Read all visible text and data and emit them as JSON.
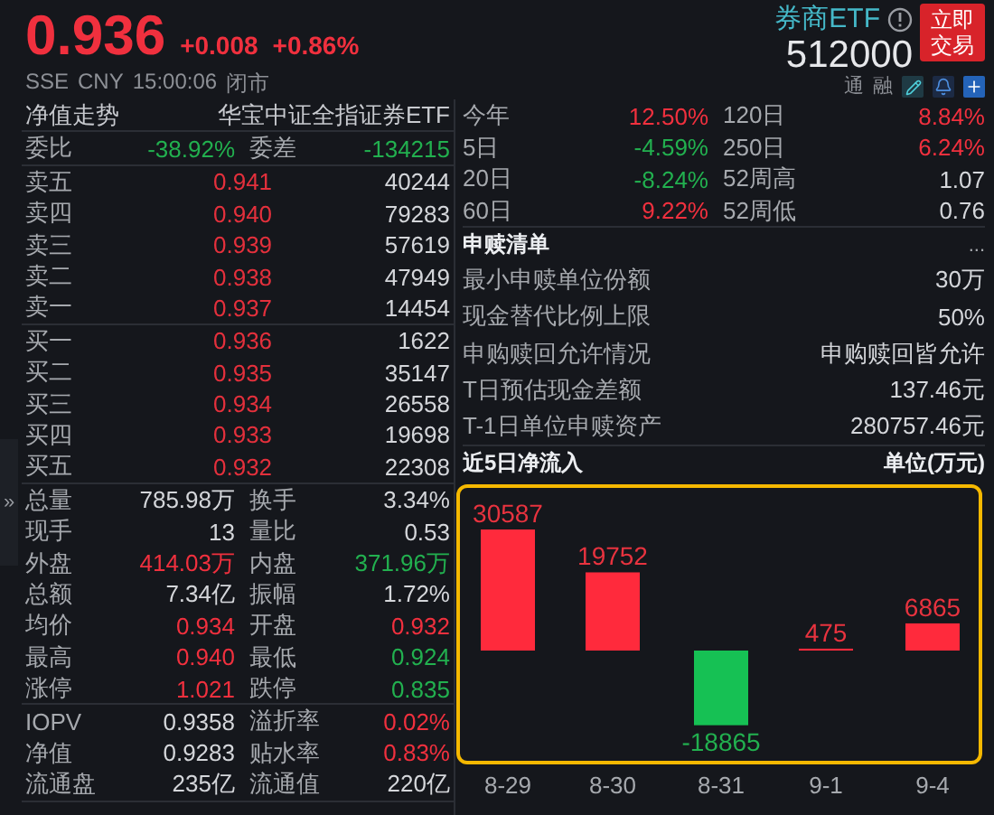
{
  "quote": {
    "price": "0.936",
    "change": "+0.008",
    "change_pct": "+0.86%",
    "exchange": "SSE",
    "currency": "CNY",
    "time": "15:00:06",
    "status": "闭市"
  },
  "security": {
    "name": "券商ETF",
    "code": "512000",
    "trade_button": [
      "立即",
      "交易"
    ],
    "tags": [
      "通",
      "融"
    ]
  },
  "side_toggle": "»",
  "order_book": {
    "title": "净值走势",
    "fund_name": "华宝中证全指证券ETF",
    "ratio": [
      {
        "label": "委比",
        "value": "-38.92%",
        "color": "#22b04f"
      },
      {
        "label": "委差",
        "value": "-134215",
        "color": "#22b04f"
      }
    ],
    "asks": [
      {
        "label": "卖五",
        "price": "0.941",
        "volume": "40244"
      },
      {
        "label": "卖四",
        "price": "0.940",
        "volume": "79283"
      },
      {
        "label": "卖三",
        "price": "0.939",
        "volume": "57619"
      },
      {
        "label": "卖二",
        "price": "0.938",
        "volume": "47949"
      },
      {
        "label": "卖一",
        "price": "0.937",
        "volume": "14454"
      }
    ],
    "bids": [
      {
        "label": "买一",
        "price": "0.936",
        "volume": "1622"
      },
      {
        "label": "买二",
        "price": "0.935",
        "volume": "35147"
      },
      {
        "label": "买三",
        "price": "0.934",
        "volume": "26558"
      },
      {
        "label": "买四",
        "price": "0.933",
        "volume": "19698"
      },
      {
        "label": "买五",
        "price": "0.932",
        "volume": "22308"
      }
    ]
  },
  "trade_stats": [
    [
      {
        "label": "总量",
        "value": "785.98万",
        "color": "#d4d6da"
      },
      {
        "label": "换手",
        "value": "3.34%",
        "color": "#d4d6da"
      }
    ],
    [
      {
        "label": "现手",
        "value": "13",
        "color": "#d4d6da"
      },
      {
        "label": "量比",
        "value": "0.53",
        "color": "#d4d6da"
      }
    ],
    [
      {
        "label": "外盘",
        "value": "414.03万",
        "color": "#f0303e"
      },
      {
        "label": "内盘",
        "value": "371.96万",
        "color": "#22b04f"
      }
    ],
    [
      {
        "label": "总额",
        "value": "7.34亿",
        "color": "#d4d6da"
      },
      {
        "label": "振幅",
        "value": "1.72%",
        "color": "#d4d6da"
      }
    ],
    [
      {
        "label": "均价",
        "value": "0.934",
        "color": "#f0303e"
      },
      {
        "label": "开盘",
        "value": "0.932",
        "color": "#f0303e"
      }
    ],
    [
      {
        "label": "最高",
        "value": "0.940",
        "color": "#f0303e"
      },
      {
        "label": "最低",
        "value": "0.924",
        "color": "#22b04f"
      }
    ],
    [
      {
        "label": "涨停",
        "value": "1.021",
        "color": "#f0303e"
      },
      {
        "label": "跌停",
        "value": "0.835",
        "color": "#22b04f"
      }
    ]
  ],
  "fund_stats": [
    [
      {
        "label": "IOPV",
        "value": "0.9358",
        "color": "#d4d6da"
      },
      {
        "label": "溢折率",
        "value": "0.02%",
        "color": "#f0303e"
      }
    ],
    [
      {
        "label": "净值",
        "value": "0.9283",
        "color": "#d4d6da"
      },
      {
        "label": "贴水率",
        "value": "0.83%",
        "color": "#f0303e"
      }
    ],
    [
      {
        "label": "流通盘",
        "value": "235亿",
        "color": "#d4d6da"
      },
      {
        "label": "流通值",
        "value": "220亿",
        "color": "#d4d6da"
      }
    ]
  ],
  "performance": [
    [
      {
        "label": "今年",
        "value": "12.50%",
        "color": "#f0303e"
      },
      {
        "label": "120日",
        "value": "8.84%",
        "color": "#f0303e"
      }
    ],
    [
      {
        "label": "5日",
        "value": "-4.59%",
        "color": "#22b04f"
      },
      {
        "label": "250日",
        "value": "6.24%",
        "color": "#f0303e"
      }
    ],
    [
      {
        "label": "20日",
        "value": "-8.24%",
        "color": "#22b04f"
      },
      {
        "label": "52周高",
        "value": "1.07",
        "color": "#d4d6da"
      }
    ],
    [
      {
        "label": "60日",
        "value": "9.22%",
        "color": "#f0303e"
      },
      {
        "label": "52周低",
        "value": "0.76",
        "color": "#d4d6da"
      }
    ]
  ],
  "subscription": {
    "title": "申赎清单",
    "more": "...",
    "rows": [
      {
        "label": "最小申赎单位份额",
        "value": "30万"
      },
      {
        "label": "现金替代比例上限",
        "value": "50%"
      },
      {
        "label": "申购赎回允许情况",
        "value": "申购赎回皆允许"
      },
      {
        "label": "T日预估现金差额",
        "value": "137.46元"
      },
      {
        "label": "T-1日单位申赎资产",
        "value": "280757.46元"
      }
    ]
  },
  "net_inflow": {
    "title": "近5日净流入",
    "unit": "单位(万元)",
    "chart_data": {
      "type": "bar",
      "categories": [
        "8-29",
        "8-30",
        "8-31",
        "9-1",
        "9-4"
      ],
      "values": [
        30587,
        19752,
        -18865,
        475,
        6865
      ],
      "data_labels": true
    }
  }
}
